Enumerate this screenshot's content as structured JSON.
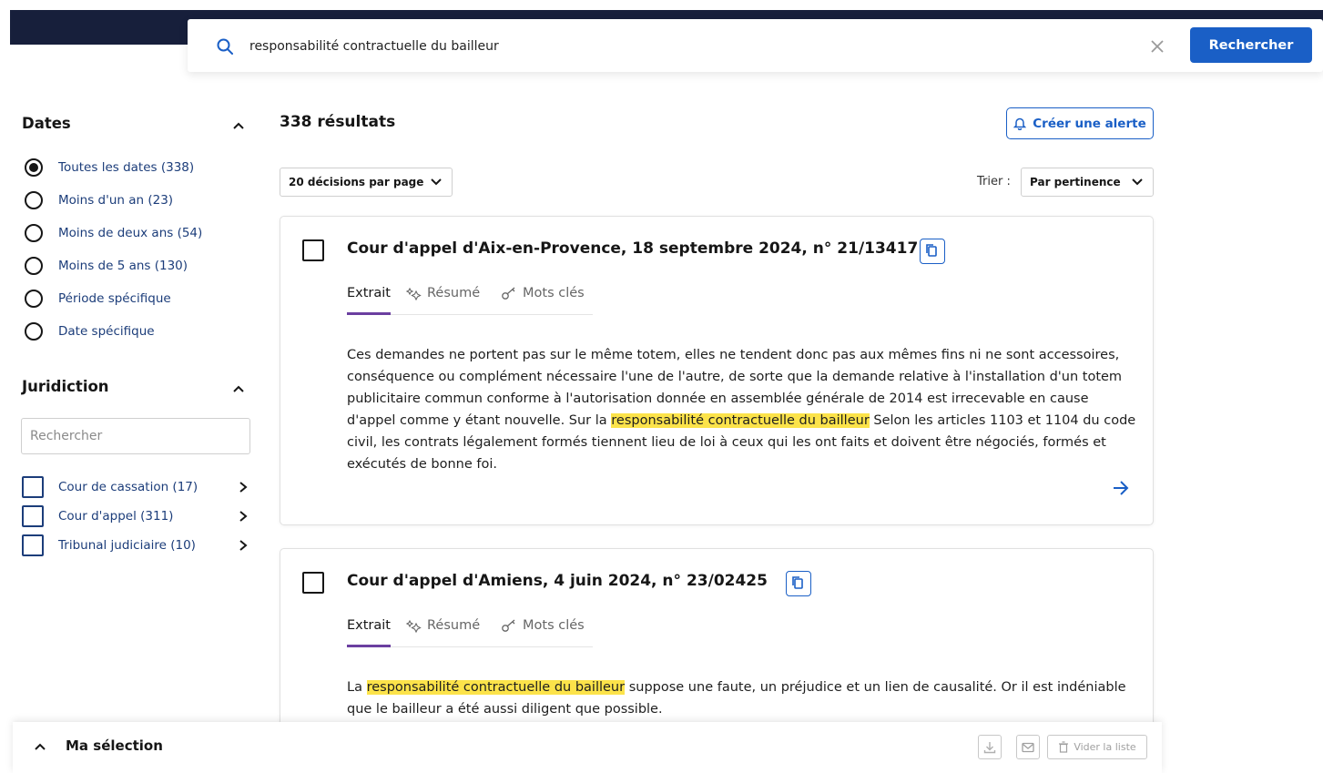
{
  "search": {
    "query": "responsabilité contractuelle du bailleur",
    "button_label": "Rechercher"
  },
  "filters": {
    "dates": {
      "title": "Dates",
      "options": [
        {
          "label": "Toutes les dates (338)",
          "checked": true
        },
        {
          "label": "Moins d'un an (23)",
          "checked": false
        },
        {
          "label": "Moins de deux ans (54)",
          "checked": false
        },
        {
          "label": "Moins de 5 ans (130)",
          "checked": false
        },
        {
          "label": "Période spécifique",
          "checked": false
        },
        {
          "label": "Date spécifique",
          "checked": false
        }
      ]
    },
    "juridiction": {
      "title": "Juridiction",
      "search_placeholder": "Rechercher",
      "options": [
        {
          "label": "Cour de cassation (17)",
          "checked": false
        },
        {
          "label": "Cour d'appel (311)",
          "checked": false
        },
        {
          "label": "Tribunal judiciaire (10)",
          "checked": false
        }
      ]
    }
  },
  "results": {
    "count_label": "338 résultats",
    "alert_button": "Créer une alerte",
    "per_page": "20 décisions par page",
    "sort_label": "Trier :",
    "sort_value": "Par pertinence",
    "items": [
      {
        "title": "Cour d'appel d'Aix-en-Provence, 18 septembre 2024, n° 21/13417",
        "tabs": [
          "Extrait",
          "Résumé",
          "Mots clés"
        ],
        "excerpt_before": "Ces demandes ne portent pas sur le même totem, elles ne tendent donc pas aux mêmes fins ni ne sont accessoires, conséquence ou complément nécessaire l'une de l'autre, de sorte que la demande relative à l'installation d'un totem publicitaire commun conforme à l'autorisation donnée en assemblée générale de 2014 est irrecevable en cause d'appel comme y étant nouvelle. Sur la ",
        "excerpt_highlight": "responsabilité contractuelle du bailleur",
        "excerpt_after": " Selon les articles 1103 et 1104 du code civil, les contrats légalement formés tiennent lieu de loi à ceux qui les ont faits et doivent être négociés, formés et exécutés de bonne foi."
      },
      {
        "title": "Cour d'appel d'Amiens, 4 juin 2024, n° 23/02425",
        "tabs": [
          "Extrait",
          "Résumé",
          "Mots clés"
        ],
        "excerpt_before": "La ",
        "excerpt_highlight": "responsabilité contractuelle du bailleur",
        "excerpt_after": " suppose une faute, un préjudice et un lien de causalité. Or il est indéniable que le bailleur a été aussi diligent que possible."
      }
    ]
  },
  "selection_bar": {
    "label": "Ma sélection",
    "clear_label": "Vider la liste"
  },
  "colors": {
    "navy_band": "#171f3b",
    "primary": "#1a5fc6",
    "link_text": "#1c3d7a",
    "highlight": "#fce34a",
    "tab_accent": "#6b3fa0"
  }
}
